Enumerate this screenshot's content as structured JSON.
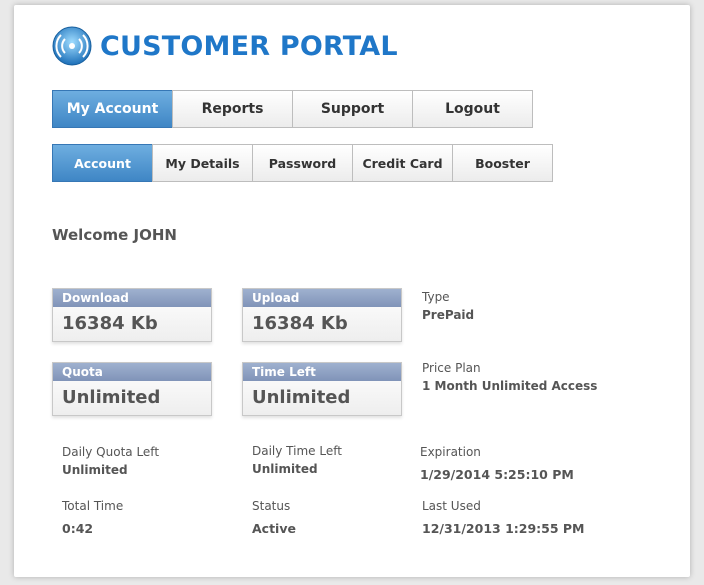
{
  "app": {
    "title": "CUSTOMER PORTAL",
    "logo_icon": "broadcast-signal-icon"
  },
  "main_tabs": [
    {
      "label": "My Account",
      "active": true
    },
    {
      "label": "Reports",
      "active": false
    },
    {
      "label": "Support",
      "active": false
    },
    {
      "label": "Logout",
      "active": false
    }
  ],
  "sub_tabs": [
    {
      "label": "Account",
      "active": true
    },
    {
      "label": "My Details",
      "active": false
    },
    {
      "label": "Password",
      "active": false
    },
    {
      "label": "Credit Card",
      "active": false
    },
    {
      "label": "Booster",
      "active": false
    }
  ],
  "welcome": "Welcome JOHN",
  "stats": {
    "download": {
      "label": "Download",
      "value": "16384 Kb"
    },
    "upload": {
      "label": "Upload",
      "value": "16384 Kb"
    },
    "quota": {
      "label": "Quota",
      "value": "Unlimited"
    },
    "time_left": {
      "label": "Time Left",
      "value": "Unlimited"
    }
  },
  "info": {
    "type": {
      "label": "Type",
      "value": "PrePaid"
    },
    "price_plan": {
      "label": "Price Plan",
      "value": "1 Month Unlimited Access"
    },
    "daily_quota_left": {
      "label": "Daily Quota Left",
      "value": "Unlimited"
    },
    "daily_time_left": {
      "label": "Daily Time Left",
      "value": "Unlimited"
    },
    "expiration": {
      "label": "Expiration",
      "value": "1/29/2014 5:25:10 PM"
    },
    "total_time": {
      "label": "Total Time",
      "value": "0:42"
    },
    "status": {
      "label": "Status",
      "value": "Active"
    },
    "last_used": {
      "label": "Last Used",
      "value": "12/31/2013 1:29:55 PM"
    }
  },
  "colors": {
    "brand": "#1f77c8",
    "active_tab": "#4a90cf",
    "stat_header": "#8e9fc2"
  }
}
